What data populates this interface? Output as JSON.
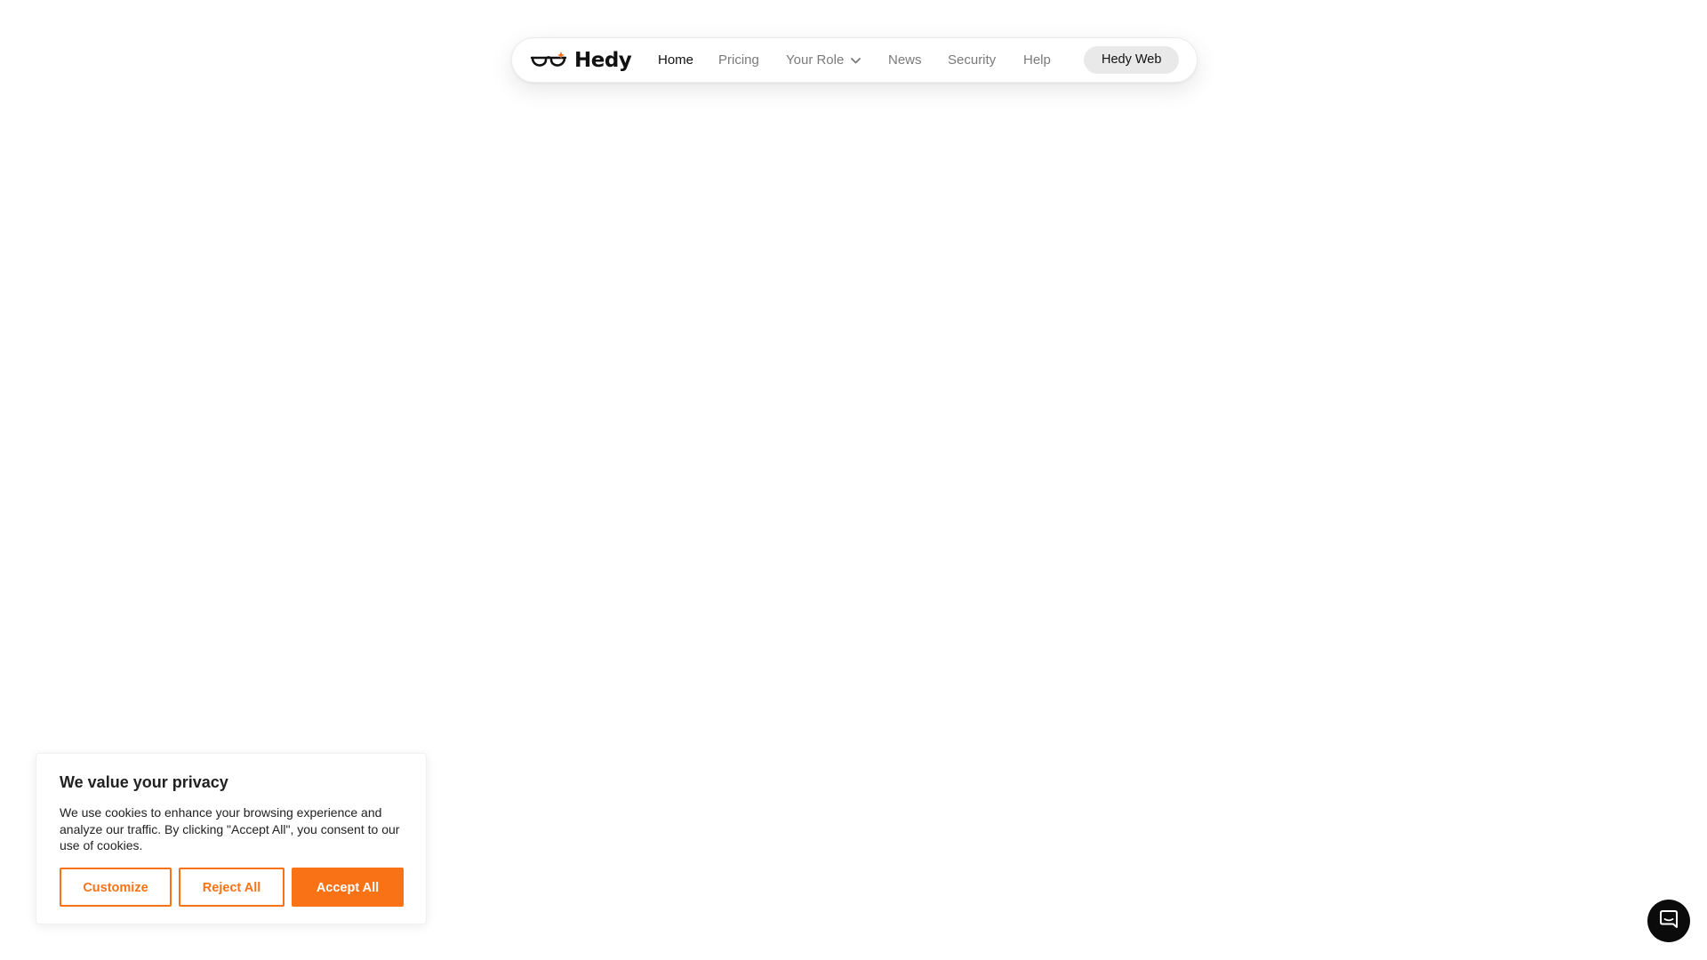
{
  "nav": {
    "brand": "Hedy",
    "links": {
      "home": "Home",
      "pricing": "Pricing",
      "role": "Your Role",
      "news": "News",
      "security": "Security",
      "help": "Help"
    },
    "cta": "Hedy Web"
  },
  "cookie": {
    "title": "We value your privacy",
    "text": "We use cookies to enhance your browsing experience and analyze our traffic. By clicking \"Accept All\", you consent to our use of cookies.",
    "buttons": {
      "customize": "Customize",
      "reject": "Reject All",
      "accept": "Accept All"
    }
  },
  "colors": {
    "accent": "#f97316",
    "text": "#111111",
    "muted": "#7a7a7a"
  },
  "icons": {
    "logo": "glasses-icon",
    "dropdown": "chevron-down-icon",
    "chat": "chat-bubble-icon"
  }
}
